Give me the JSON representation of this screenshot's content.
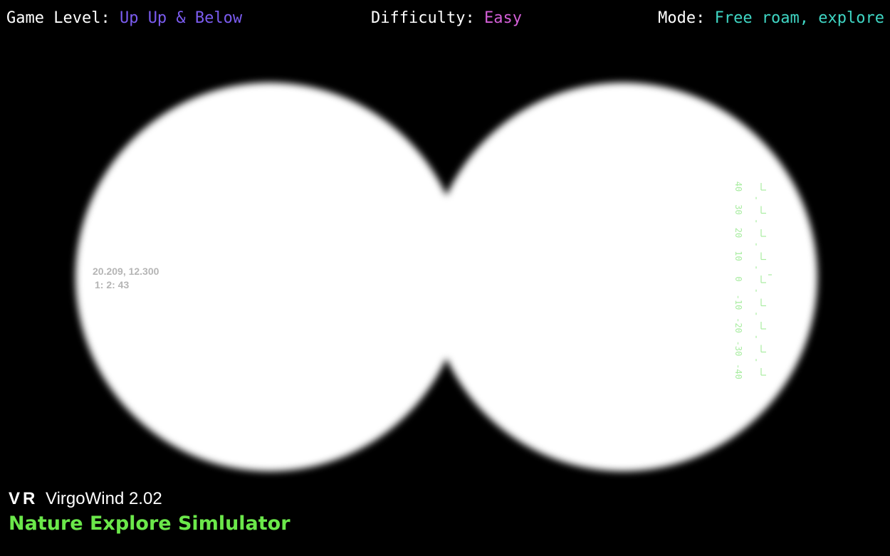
{
  "hud": {
    "level_label": "Game Level:",
    "level_value": "Up Up & Below",
    "difficulty_label": "Difficulty:",
    "difficulty_value": "Easy",
    "mode_label": "Mode:",
    "mode_value": "Free roam, explore"
  },
  "readout": {
    "coordinates": "20.209, 12.300",
    "time": "1: 2: 43"
  },
  "pitch_ladder": {
    "labels": [
      "40",
      "30",
      "20",
      "10",
      "0",
      "-10",
      "-20",
      "-30",
      "-40"
    ],
    "current": 0
  },
  "brand": {
    "vr": "VR",
    "product": "VirgoWind 2.02",
    "title": "Nature Explore Simlulator"
  },
  "colors": {
    "level": "#7b5cf0",
    "difficulty": "#d45fd8",
    "mode": "#3fd6c4",
    "title": "#6be84a",
    "ladder": "#a8eca0"
  }
}
